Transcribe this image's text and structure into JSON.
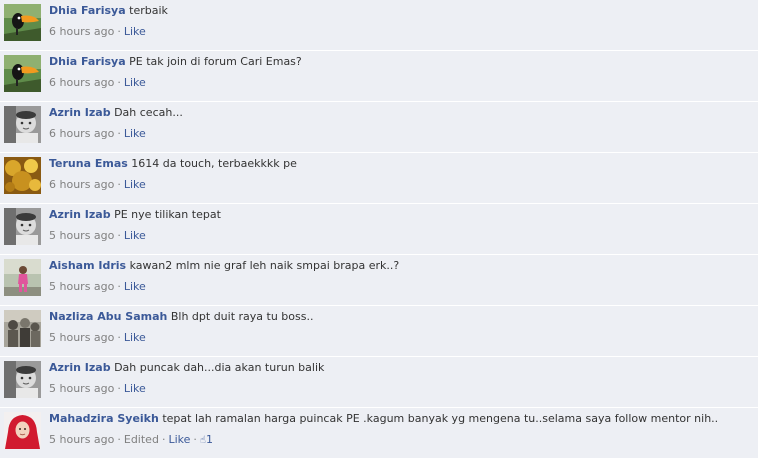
{
  "comments": [
    {
      "author": "Dhia Farisya",
      "text": "terbaik",
      "time": "6 hours ago",
      "like": "Like",
      "avatar": "toucan-avatar"
    },
    {
      "author": "Dhia Farisya",
      "text": "PE tak join di forum Cari Emas?",
      "time": "6 hours ago",
      "like": "Like",
      "avatar": "toucan-avatar"
    },
    {
      "author": "Azrin Izab",
      "text": "Dah cecah...",
      "time": "6 hours ago",
      "like": "Like",
      "avatar": "baby-avatar"
    },
    {
      "author": "Teruna Emas",
      "text": "1614 da touch, terbaekkkk pe",
      "time": "6 hours ago",
      "like": "Like",
      "avatar": "gold-avatar"
    },
    {
      "author": "Azrin Izab",
      "text": "PE nye tilikan tepat",
      "time": "5 hours ago",
      "like": "Like",
      "avatar": "baby-avatar"
    },
    {
      "author": "Aisham Idris",
      "text": "kawan2 mlm nie graf leh naik smpai brapa erk..?",
      "time": "5 hours ago",
      "like": "Like",
      "avatar": "child-avatar"
    },
    {
      "author": "Nazliza Abu Samah",
      "text": "Blh dpt duit raya tu boss..",
      "time": "5 hours ago",
      "like": "Like",
      "avatar": "group-avatar"
    },
    {
      "author": "Azrin Izab",
      "text": "Dah puncak dah...dia akan turun balik",
      "time": "5 hours ago",
      "like": "Like",
      "avatar": "baby-avatar"
    },
    {
      "author": "Mahadzira Syeikh",
      "text": "tepat lah ramalan harga puincak PE .kagum banyak yg mengena tu..selama saya follow mentor nih..",
      "time": "5 hours ago",
      "edited": "Edited",
      "like": "Like",
      "likes": "1",
      "avatar": "hijab-avatar"
    }
  ],
  "colors": {
    "link": "#3b5998",
    "meta": "#808080",
    "row_bg": "#edeff4",
    "text": "#333333"
  }
}
